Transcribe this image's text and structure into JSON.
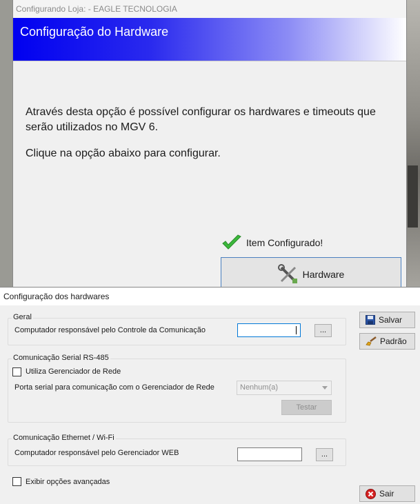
{
  "back_window": {
    "title": "Configurando Loja:  - EAGLE TECNOLOGIA",
    "banner_title": "Configuração do Hardware",
    "description_1": "Através desta opção é possível configurar os hardwares e timeouts que serão utilizados no MGV 6.",
    "description_2": "Clique na opção abaixo para configurar.",
    "status_label": "Item Configurado!",
    "hardware_button": "Hardware",
    "icons": [
      "checkmark-icon",
      "tools-icon"
    ],
    "colors": {
      "banner_start": "#0000f0",
      "banner_end": "#ffffff",
      "check_green": "#3cb93c"
    }
  },
  "dialog": {
    "title": "Configuração dos hardwares",
    "geral": {
      "legend": "Geral",
      "label": "Computador responsável pelo Controle da Comunicação",
      "value": "",
      "browse": "..."
    },
    "serial": {
      "legend": "Comunicação Serial RS-485",
      "checkbox_label": "Utiliza Gerenciador de Rede",
      "checked": false,
      "port_label": "Porta serial para comunicação com o Gerenciador de Rede",
      "port_value": "Nenhum(a)",
      "test_button": "Testar"
    },
    "ethernet": {
      "legend": "Comunicação Ethernet / Wi-Fi",
      "label": "Computador responsável pelo Gerenciador WEB",
      "value": "",
      "browse": "..."
    },
    "advanced_label": "Exibir opções avançadas",
    "advanced_checked": false,
    "buttons": {
      "save": "Salvar",
      "default": "Padrão",
      "exit": "Sair"
    },
    "icons": [
      "floppy-disk-icon",
      "brush-icon",
      "exit-icon"
    ]
  }
}
